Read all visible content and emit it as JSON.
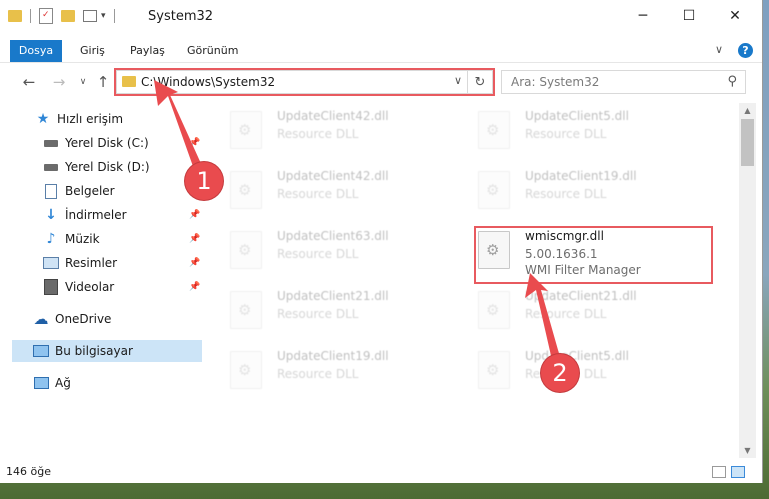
{
  "window": {
    "title": "System32",
    "minimize_glyph": "─",
    "maximize_glyph": "☐",
    "close_glyph": "✕"
  },
  "ribbon": {
    "tabs": [
      "Dosya",
      "Giriş",
      "Paylaş",
      "Görünüm"
    ],
    "expand_glyph": "∨",
    "help_glyph": "?"
  },
  "addressbar": {
    "path": "C:\\Windows\\System32",
    "dropdown_glyph": "∨",
    "refresh_glyph": "↻"
  },
  "search": {
    "placeholder": "Ara: System32",
    "icon": "search-icon"
  },
  "navpane": {
    "items": [
      {
        "label": "Hızlı erişim",
        "icon": "star-icon",
        "pinned": false
      },
      {
        "label": "Yerel Disk (C:)",
        "icon": "drive-icon",
        "pinned": true
      },
      {
        "label": "Yerel Disk (D:)",
        "icon": "drive-icon",
        "pinned": false
      },
      {
        "label": "Belgeler",
        "icon": "documents-icon",
        "pinned": true
      },
      {
        "label": "İndirmeler",
        "icon": "download-icon",
        "pinned": true
      },
      {
        "label": "Müzik",
        "icon": "music-icon",
        "pinned": true
      },
      {
        "label": "Resimler",
        "icon": "pictures-icon",
        "pinned": true
      },
      {
        "label": "Videolar",
        "icon": "videos-icon",
        "pinned": true
      },
      {
        "label": "OneDrive",
        "icon": "cloud-icon",
        "pinned": false
      },
      {
        "label": "Bu bilgisayar",
        "icon": "computer-icon",
        "pinned": false,
        "selected": true
      },
      {
        "label": "Ağ",
        "icon": "network-icon",
        "pinned": false
      }
    ]
  },
  "files": [
    {
      "name": "UpdateClient42.dll",
      "type": "Resource DLL"
    },
    {
      "name": "UpdateClient5.dll",
      "type": "Resource DLL"
    },
    {
      "name": "UpdateClient42.dll",
      "type": "Resource DLL"
    },
    {
      "name": "UpdateClient19.dll",
      "type": "Resource DLL"
    },
    {
      "name": "UpdateClient63.dll",
      "type": "Resource DLL"
    },
    {
      "name": "wmiscmgr.dll",
      "version": "5.00.1636.1",
      "type": "WMI Filter Manager"
    },
    {
      "name": "UpdateClient21.dll",
      "type": "Resource DLL"
    },
    {
      "name": "UpdateClient21.dll",
      "type": "Resource DLL"
    },
    {
      "name": "UpdateClient19.dll",
      "type": "Resource DLL"
    },
    {
      "name": "UpdateClient5.dll",
      "type": "Resource DLL"
    }
  ],
  "status": {
    "item_count": "146 öğe"
  },
  "annotations": {
    "step1": "1",
    "step2": "2",
    "color": "#e94b4e"
  }
}
